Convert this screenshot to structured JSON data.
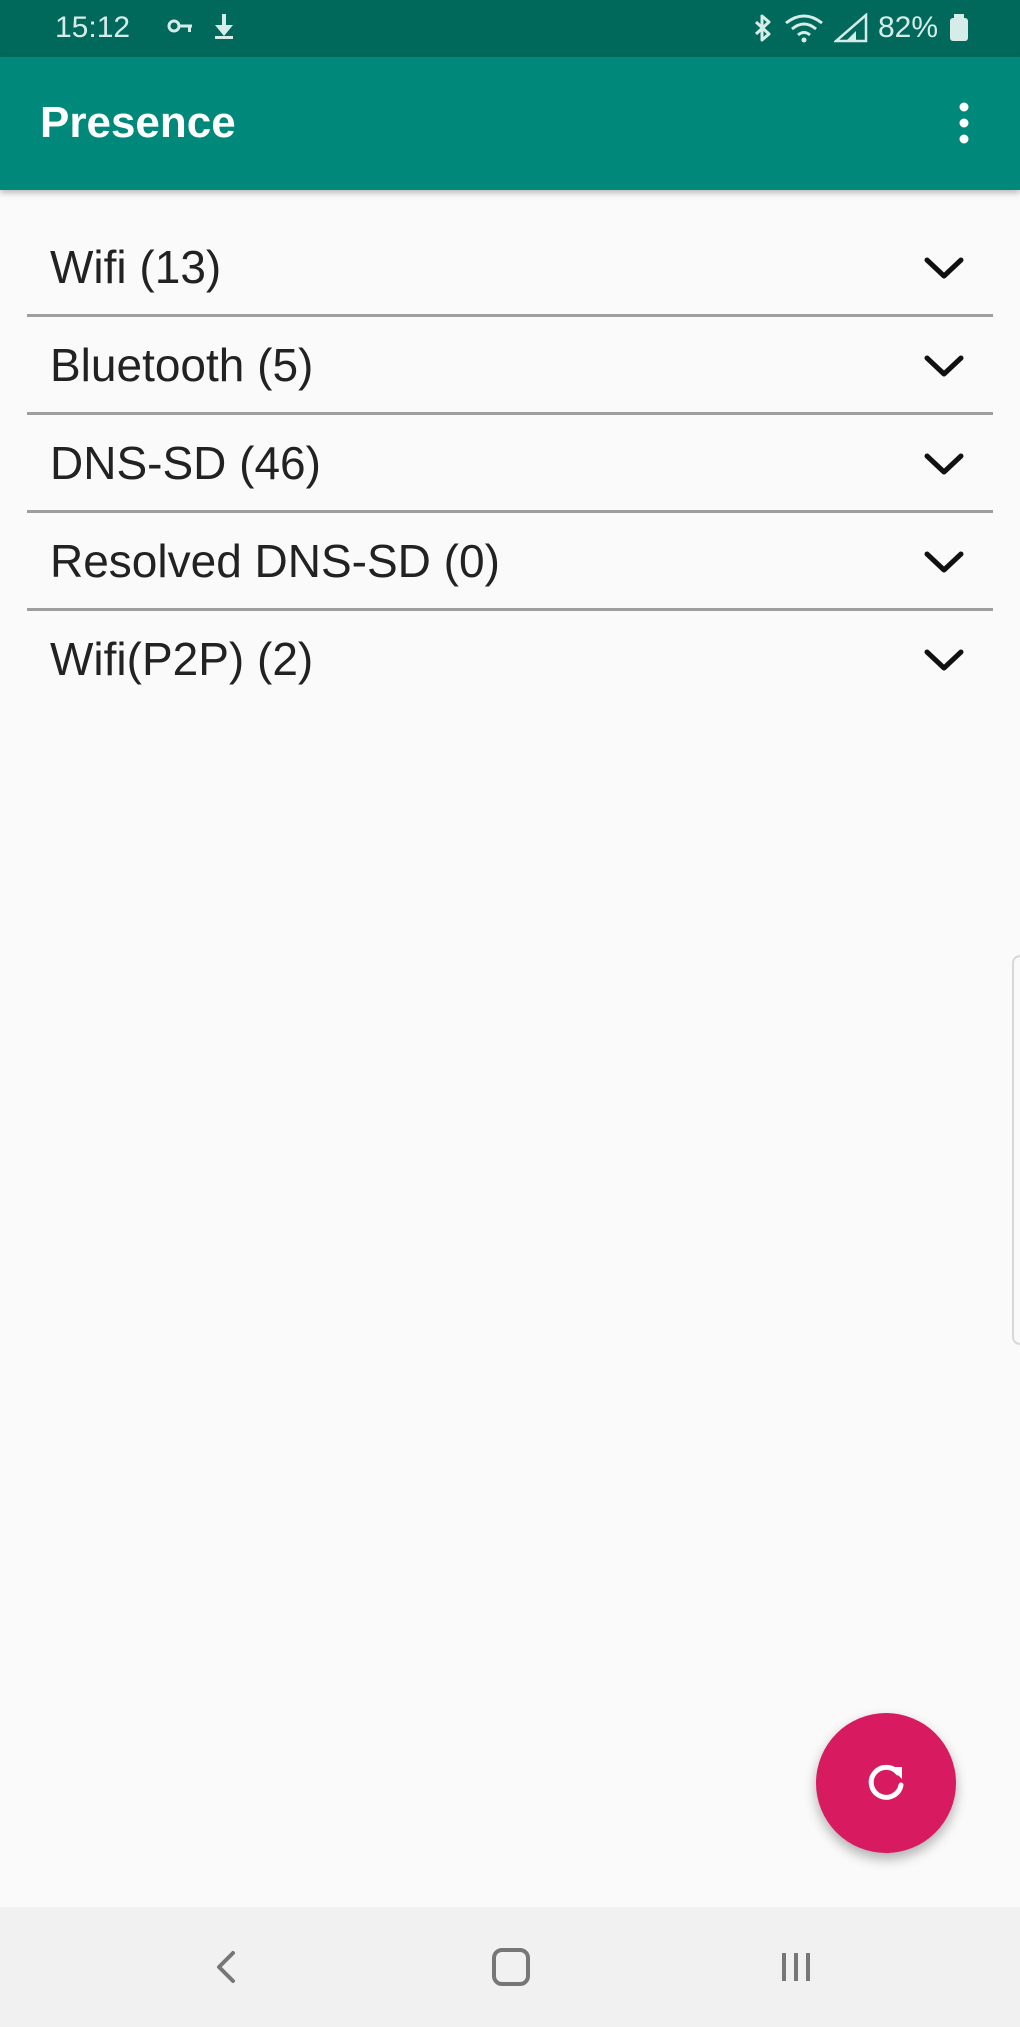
{
  "status_bar": {
    "time": "15:12",
    "battery": "82%",
    "left_icons": [
      "vpn-key-icon",
      "download-icon"
    ],
    "right_icons": [
      "bluetooth-icon",
      "wifi-icon",
      "cell-signal-icon",
      "battery-icon"
    ]
  },
  "app_bar": {
    "title": "Presence",
    "menu_icon": "more-vert-icon"
  },
  "list": {
    "items": [
      {
        "label": "Wifi (13)"
      },
      {
        "label": "Bluetooth (5)"
      },
      {
        "label": "DNS-SD (46)"
      },
      {
        "label": "Resolved DNS-SD (0)"
      },
      {
        "label": "Wifi(P2P) (2)"
      }
    ],
    "expand_icon": "chevron-down-icon"
  },
  "fab": {
    "icon": "refresh-icon"
  },
  "nav_bar": {
    "icons": [
      "back-icon",
      "home-icon",
      "recents-icon"
    ]
  },
  "colors": {
    "status_bar": "#00695c",
    "app_bar": "#00897b",
    "fab": "#d81b60",
    "background": "#fafafa",
    "divider": "#9e9e9e",
    "text": "#222222"
  }
}
